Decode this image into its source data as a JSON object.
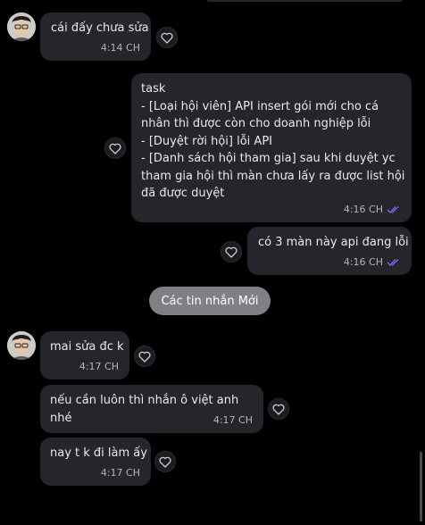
{
  "messages": [
    {
      "text": "cái đấy chưa sửa",
      "time": "4:14 CH"
    },
    {
      "text": "task\n- [Loại hội viên] API insert gói mới cho cá nhân thì được còn cho doanh nghiệp lỗi\n- [Duyệt rời hội] lỗi API\n- [Danh sách hội tham gia] sau khi duyệt yc tham gia hội thì màn chưa lấy ra được list hội đã được duyệt",
      "time": "4:16 CH"
    },
    {
      "text": "có 3 màn này api đang lỗi",
      "time": "4:16 CH"
    },
    {
      "text": "mai sửa đc k",
      "time": "4:17 CH"
    },
    {
      "text": "nếu cần luôn thì nhắn ô việt anh nhé",
      "time": "4:17 CH"
    },
    {
      "text": "nay t k đi làm ấy",
      "time": "4:17 CH"
    }
  ],
  "divider": {
    "label": "Các tin nhắn Mới"
  },
  "colors": {
    "background": "#000000",
    "bubble": "#25262b",
    "read_check": "#7b68ee",
    "divider": "#7f8086"
  },
  "icons": {
    "react": "heart-outline-icon",
    "read": "double-check-icon"
  }
}
